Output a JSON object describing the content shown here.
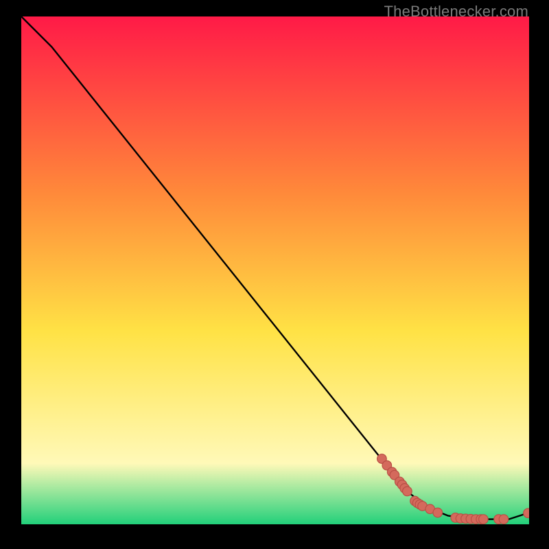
{
  "watermark": "TheBottlenecker.com",
  "colors": {
    "background": "#000000",
    "gradient_top": "#ff1a47",
    "gradient_mid_upper": "#ff8a3a",
    "gradient_mid": "#ffe245",
    "gradient_lower": "#fff9b8",
    "gradient_bottom": "#22d07a",
    "line": "#000000",
    "marker_fill": "#d46a5c",
    "marker_stroke": "#b94f45"
  },
  "chart_data": {
    "type": "line",
    "title": "",
    "xlabel": "",
    "ylabel": "",
    "xlim": [
      0,
      100
    ],
    "ylim": [
      0,
      100
    ],
    "grid": false,
    "legend": false,
    "series": [
      {
        "name": "curve",
        "x": [
          0,
          6,
          10,
          20,
          30,
          40,
          50,
          60,
          70,
          73,
          76,
          80,
          84,
          88,
          90,
          93,
          96,
          100
        ],
        "y": [
          100,
          94,
          89,
          76.5,
          64,
          51.5,
          39,
          26.5,
          14,
          10.3,
          6.5,
          3.3,
          1.7,
          1.1,
          1.0,
          1.0,
          1.0,
          2.3
        ]
      }
    ],
    "markers": {
      "name": "points",
      "x": [
        71,
        72,
        73,
        73.5,
        74.5,
        75,
        75.5,
        76,
        77.5,
        78,
        78.5,
        79,
        80.5,
        82,
        85.5,
        86.5,
        87.5,
        88.5,
        89.5,
        90.5,
        91,
        94,
        95,
        99.8
      ],
      "y": [
        12.9,
        11.6,
        10.3,
        9.7,
        8.4,
        7.8,
        7.1,
        6.5,
        4.6,
        4.2,
        3.9,
        3.6,
        3.0,
        2.3,
        1.3,
        1.15,
        1.1,
        1.05,
        1.0,
        1.0,
        1.0,
        1.0,
        1.0,
        2.2
      ]
    }
  }
}
